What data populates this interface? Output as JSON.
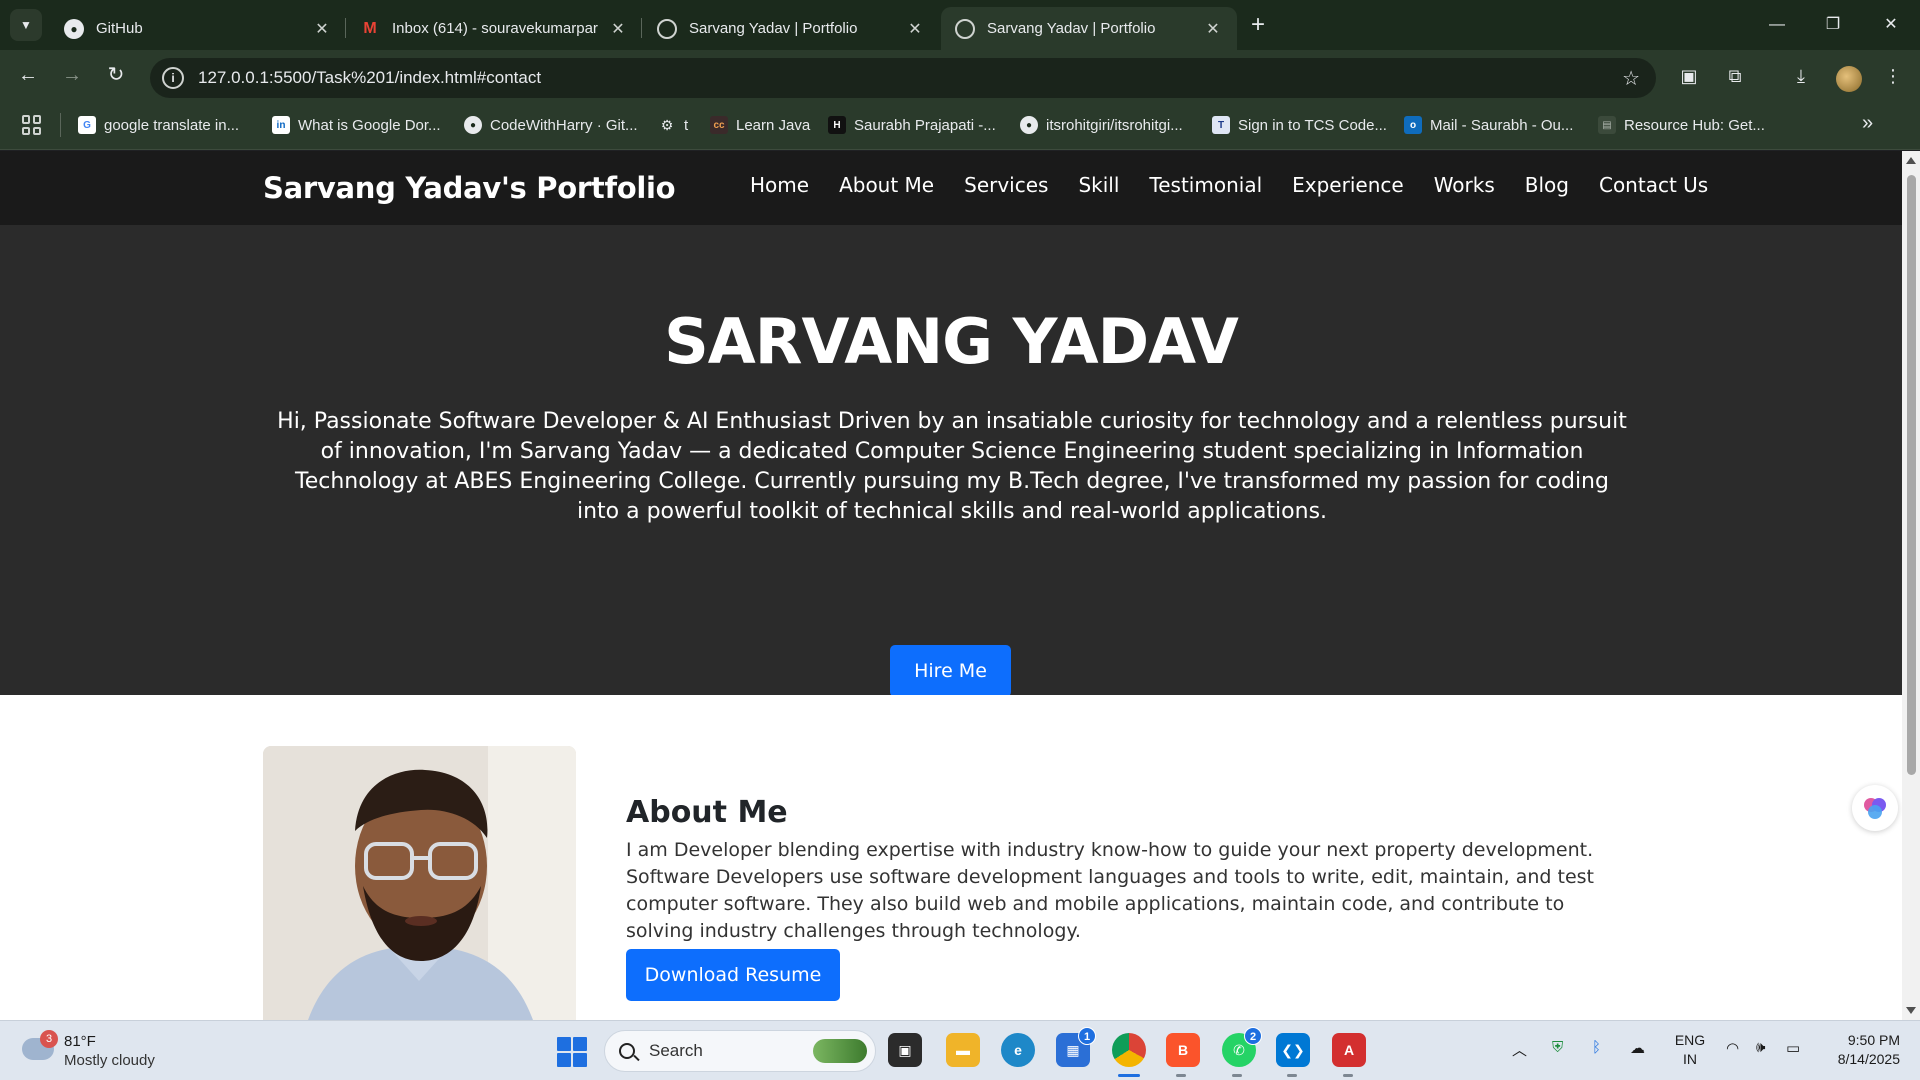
{
  "browser": {
    "tabs": [
      {
        "title": "GitHub",
        "favicon": "github-icon"
      },
      {
        "title": "Inbox (614) - souravekumarpar",
        "favicon": "gmail-icon"
      },
      {
        "title": "Sarvang Yadav | Portfolio",
        "favicon": "globe-icon"
      },
      {
        "title": "Sarvang Yadav | Portfolio",
        "favicon": "globe-icon",
        "active": true
      }
    ],
    "url": "127.0.0.1:5500/Task%201/index.html#contact",
    "bookmarks": [
      {
        "label": "google translate in...",
        "icon": "google-icon"
      },
      {
        "label": "What is Google Dor...",
        "icon": "linkedin-icon"
      },
      {
        "label": "CodeWithHarry · Git...",
        "icon": "github-icon"
      },
      {
        "label": "t",
        "icon": "openai-icon"
      },
      {
        "label": "Learn Java",
        "icon": "cc-icon"
      },
      {
        "label": "Saurabh Prajapati -...",
        "icon": "hackerrank-icon"
      },
      {
        "label": "itsrohitgiri/itsrohitgi...",
        "icon": "github-icon"
      },
      {
        "label": "Sign in to TCS Code...",
        "icon": "tcs-icon"
      },
      {
        "label": "Mail - Saurabh - Ou...",
        "icon": "outlook-icon"
      },
      {
        "label": "Resource Hub: Get...",
        "icon": "resource-icon"
      }
    ]
  },
  "site": {
    "brand": "Sarvang Yadav's Portfolio",
    "nav": [
      "Home",
      "About Me",
      "Services",
      "Skill",
      "Testimonial",
      "Experience",
      "Works",
      "Blog",
      "Contact Us"
    ],
    "hero": {
      "name": "SARVANG YADAV",
      "intro": "Hi, Passionate Software Developer & AI Enthusiast Driven by an insatiable curiosity for technology and a relentless pursuit of innovation, I'm Sarvang Yadav — a dedicated Computer Science Engineering student specializing in Information Technology at ABES Engineering College. Currently pursuing my B.Tech degree, I've transformed my passion for coding into a powerful toolkit of technical skills and real-world applications.",
      "cta": "Hire Me"
    },
    "about": {
      "heading": "About Me",
      "line1": "I am Developer blending expertise with industry know-how to guide your next property development.",
      "line2": "Software Developers use software development languages and tools to write, edit, maintain, and test computer software. They also build web and mobile applications, maintain code, and contribute to solving industry challenges through technology.",
      "cta": "Download Resume"
    }
  },
  "taskbar": {
    "weather_badge": "3",
    "temperature": "81°F",
    "condition": "Mostly cloudy",
    "search_placeholder": "Search",
    "store_badge": "1",
    "whatsapp_badge": "2",
    "lang_line1": "ENG",
    "lang_line2": "IN",
    "time": "9:50 PM",
    "date": "8/14/2025"
  },
  "colors": {
    "accent": "#0d6efd",
    "nav_bg": "#1a1a1a",
    "hero_bg": "#2b2b2b"
  }
}
